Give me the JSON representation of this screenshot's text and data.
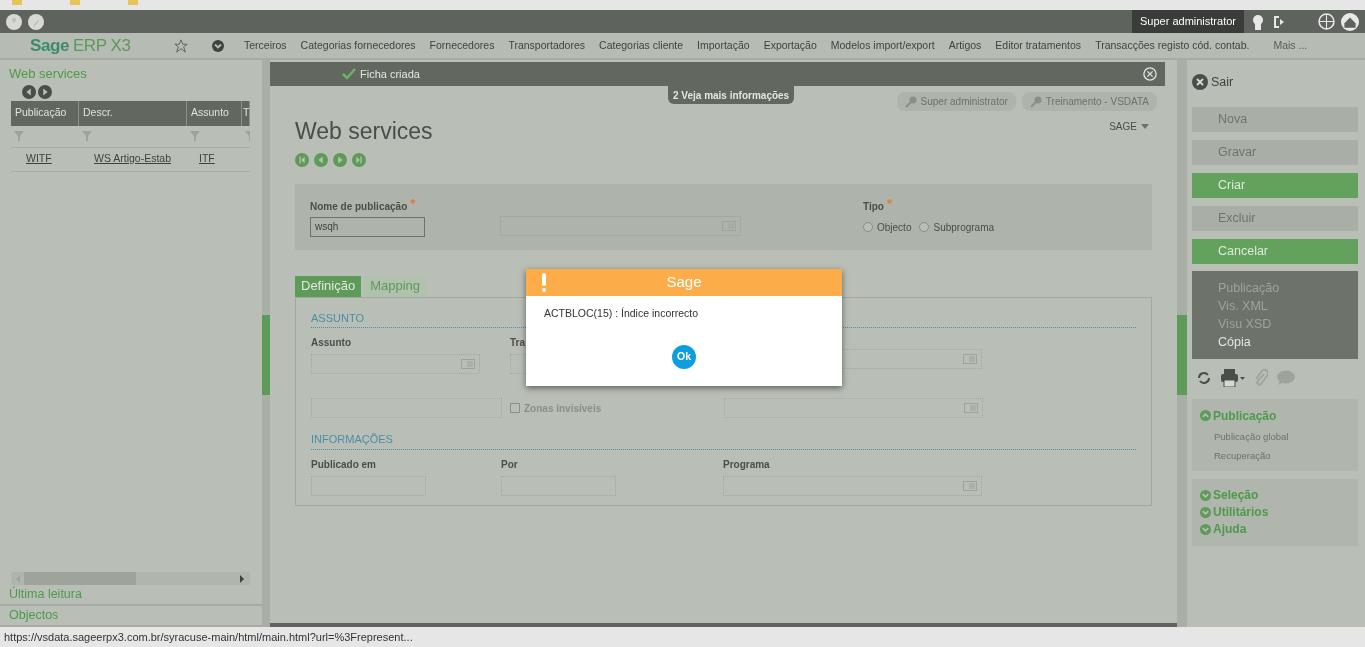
{
  "top_bar": {
    "user": "Super administrator"
  },
  "nav": {
    "logo_brand": "Sage",
    "logo_product": "ERP X3",
    "items": [
      "Terceiros",
      "Categorias fornecedores",
      "Fornecedores",
      "Transportadores",
      "Categorias cliente",
      "Importação",
      "Exportação",
      "Modelos import/export",
      "Artigos",
      "Editor tratamentos",
      "Transacções registo cód. contab.",
      "Mais ..."
    ]
  },
  "left_panel": {
    "title": "Web services",
    "table": {
      "columns": [
        "Publicação",
        "Descr.",
        "Assunto",
        "T"
      ],
      "rows": [
        [
          "WITF",
          "WS Artigo-Estab",
          "ITF"
        ]
      ]
    },
    "links": [
      "Última leitura",
      "Objectos"
    ]
  },
  "notification": {
    "message": "Ficha criada",
    "more_info": "2 Veja mais informações"
  },
  "badges": [
    "Super administrator",
    "Treinamento - VSDATA"
  ],
  "page": {
    "title": "Web services",
    "folder": "SAGE"
  },
  "header_form": {
    "name_label": "Nome de publicação",
    "name_value": "wsqh",
    "required_mark": "*",
    "type_label": "Tipo",
    "type_required_mark": "*",
    "type_options": [
      {
        "label": "Objecto",
        "selected": false
      },
      {
        "label": "Subprograma",
        "selected": false
      }
    ]
  },
  "tabs": [
    {
      "label": "Definição",
      "selected": true
    },
    {
      "label": "Mapping",
      "selected": false
    }
  ],
  "sections": [
    {
      "title": "ASSUNTO",
      "fields_row1": [
        "Assunto",
        "Tra"
      ],
      "checkbox": {
        "label": "Zonas invisíveis",
        "checked": false
      }
    },
    {
      "title": "INFORMAÇÕES",
      "fields_row1": [
        "Publicado em",
        "Por",
        "Programa"
      ]
    }
  ],
  "dialog": {
    "title": "Sage",
    "message": "ACTBLOC(15) : Índice incorrecto",
    "button": "Ok"
  },
  "right_panel": {
    "close": "Sair",
    "actions": [
      {
        "label": "Nova",
        "disabled": true
      },
      {
        "label": "Gravar",
        "disabled": true
      },
      {
        "label": "Criar",
        "disabled": false
      },
      {
        "label": "Excluir",
        "disabled": true
      },
      {
        "label": "Cancelar",
        "disabled": false
      }
    ],
    "menu": [
      {
        "label": "Publicação",
        "disabled": true
      },
      {
        "label": "Vis. XML",
        "disabled": true
      },
      {
        "label": "Visu XSD",
        "disabled": true
      },
      {
        "label": "Cópia",
        "disabled": false
      }
    ],
    "groups": [
      {
        "label": "Publicação",
        "expanded": true,
        "children": [
          "Publicação global",
          "Recuperação"
        ]
      },
      {
        "label": "Seleção",
        "expanded": false
      },
      {
        "label": "Utilitários",
        "expanded": false
      },
      {
        "label": "Ajuda",
        "expanded": false
      }
    ]
  },
  "status_bar": {
    "url": "https://vsdata.sageerpx3.com.br/syracuse-main/html/main.html?url=%3Frepresent..."
  }
}
